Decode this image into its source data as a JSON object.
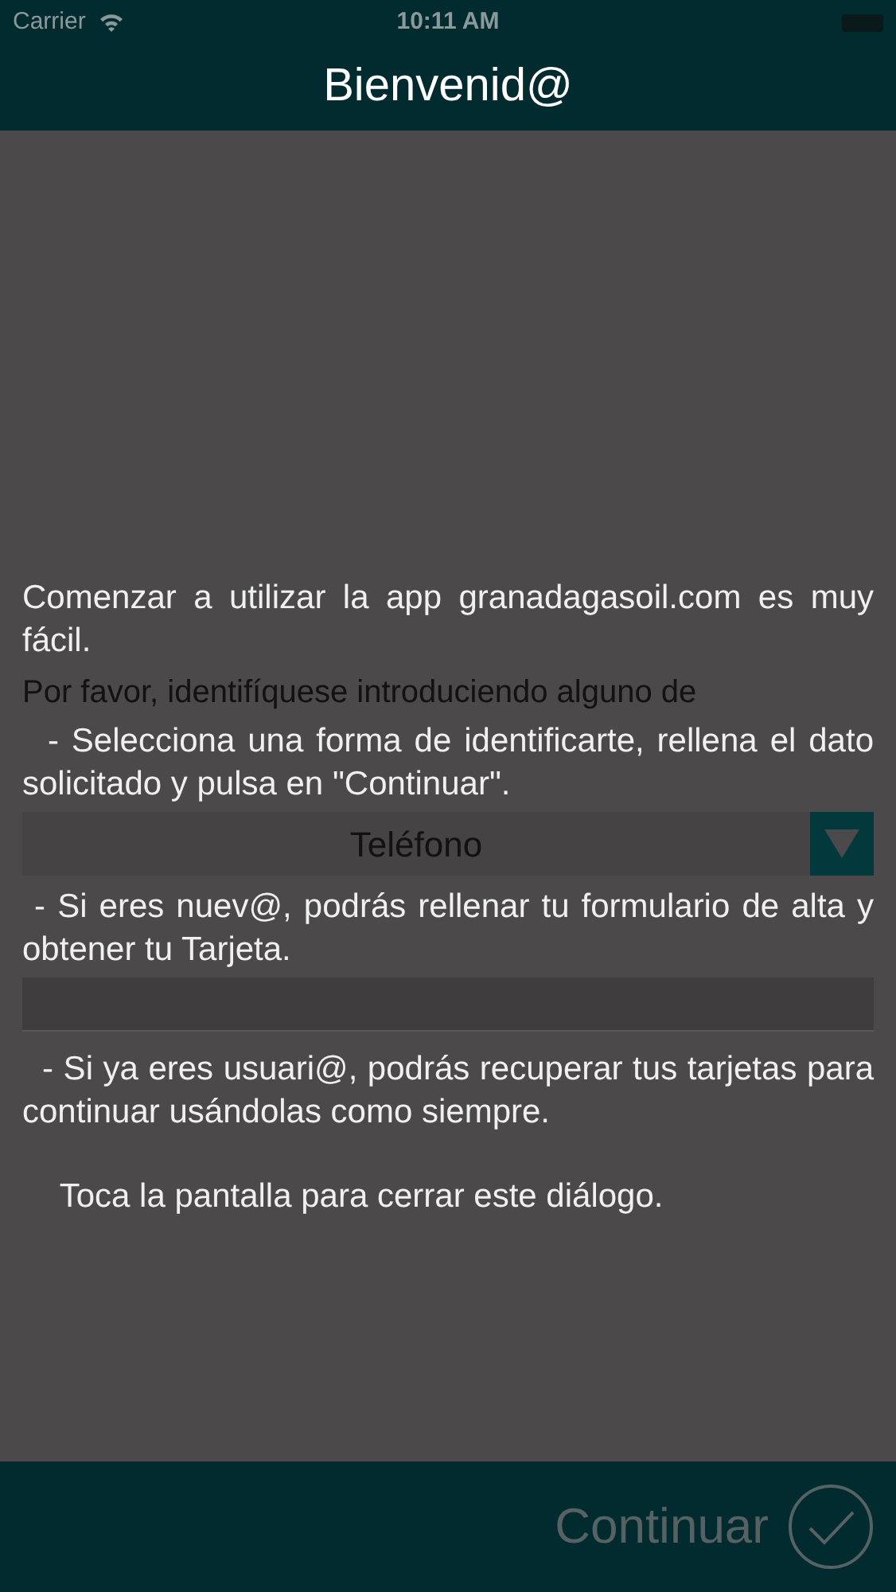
{
  "status_bar": {
    "carrier": "Carrier",
    "time": "10:11 AM"
  },
  "nav_bar": {
    "title": "Bienvenid@"
  },
  "form": {
    "prompt": "Por favor, identifíquese introduciendo alguno de",
    "dropdown": {
      "value": "Teléfono"
    }
  },
  "dialog": {
    "paragraphs": [
      "Comenzar a utilizar la app granadagasoil.com es muy fácil.",
      "  - Selecciona una forma de identificarte, rellena el dato solicitado y pulsa en \"Continuar\".",
      " - Si eres nuev@, podrás rellenar tu formulario de alta y obtener tu Tarjeta.",
      "  - Si ya eres usuari@, podrás recuperar tus tarjetas para continuar usándolas como siempre.",
      "    Toca la pantalla para cerrar este diálogo."
    ]
  },
  "footer": {
    "button": {
      "label": "Continuar",
      "disabled": true
    }
  }
}
